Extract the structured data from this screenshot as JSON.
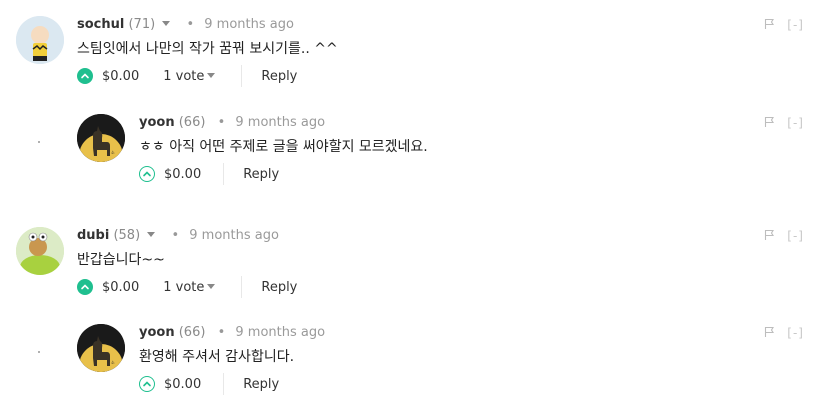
{
  "comments": [
    {
      "author": "sochul",
      "reputation": "(71)",
      "separator": "•",
      "time": "9 months ago",
      "text": "스팀잇에서 나만의 작가 꿈꿔 보시기를.. ^^",
      "payout": "$0.00",
      "votes": "1 vote",
      "reply": "Reply",
      "collapse": "[-]",
      "avatar_icon": "charlie-brown-avatar"
    },
    {
      "author": "yoon",
      "reputation": "(66)",
      "separator": "•",
      "time": "9 months ago",
      "text": "ㅎㅎ 아직 어떤 주제로 글을 써야할지 모르겠네요.",
      "payout": "$0.00",
      "reply": "Reply",
      "collapse": "[-]",
      "avatar_icon": "alpaca-avatar"
    },
    {
      "author": "dubi",
      "reputation": "(58)",
      "separator": "•",
      "time": "9 months ago",
      "text": "반갑습니다~~",
      "payout": "$0.00",
      "votes": "1 vote",
      "reply": "Reply",
      "collapse": "[-]",
      "avatar_icon": "frog-avatar"
    },
    {
      "author": "yoon",
      "reputation": "(66)",
      "separator": "•",
      "time": "9 months ago",
      "text": "환영해 주셔서 감사합니다.",
      "payout": "$0.00",
      "reply": "Reply",
      "collapse": "[-]",
      "avatar_icon": "alpaca-avatar"
    }
  ],
  "colors": {
    "accent": "#1fbf8f",
    "alpaca_bg": "#e8c04a",
    "avatar_dark": "#1a1a1a"
  }
}
